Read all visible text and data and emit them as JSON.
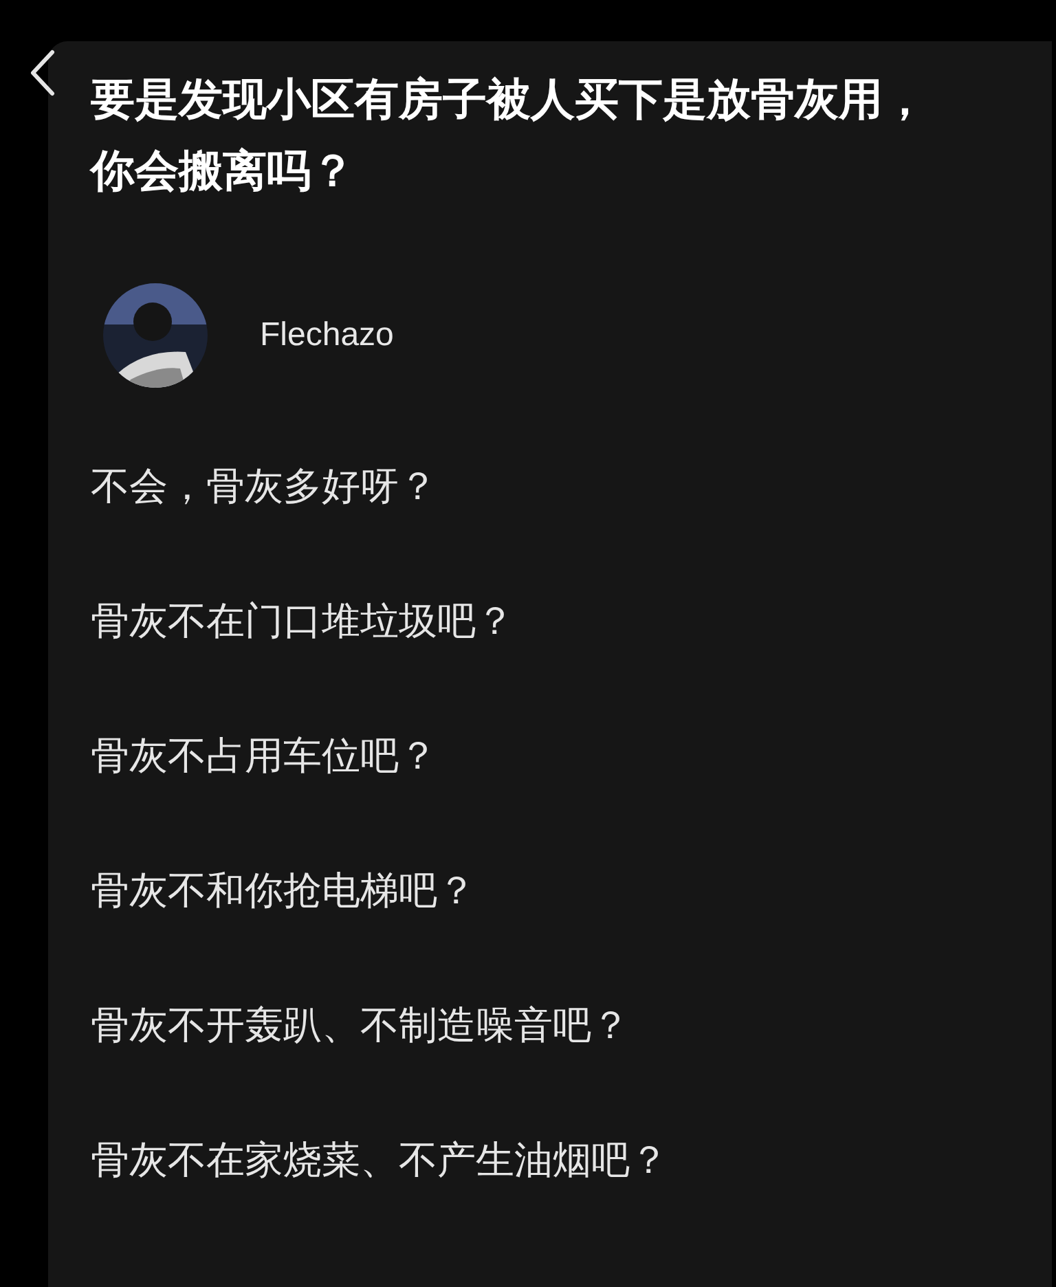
{
  "title": "要是发现小区有房子被人买下是放骨灰用，你会搬离吗？",
  "answer": {
    "author": "Flechazo",
    "lines": [
      "不会，骨灰多好呀？",
      "骨灰不在门口堆垃圾吧？",
      "骨灰不占用车位吧？",
      "骨灰不和你抢电梯吧？",
      "骨灰不开轰趴、不制造噪音吧？",
      "骨灰不在家烧菜、不产生油烟吧？"
    ]
  }
}
